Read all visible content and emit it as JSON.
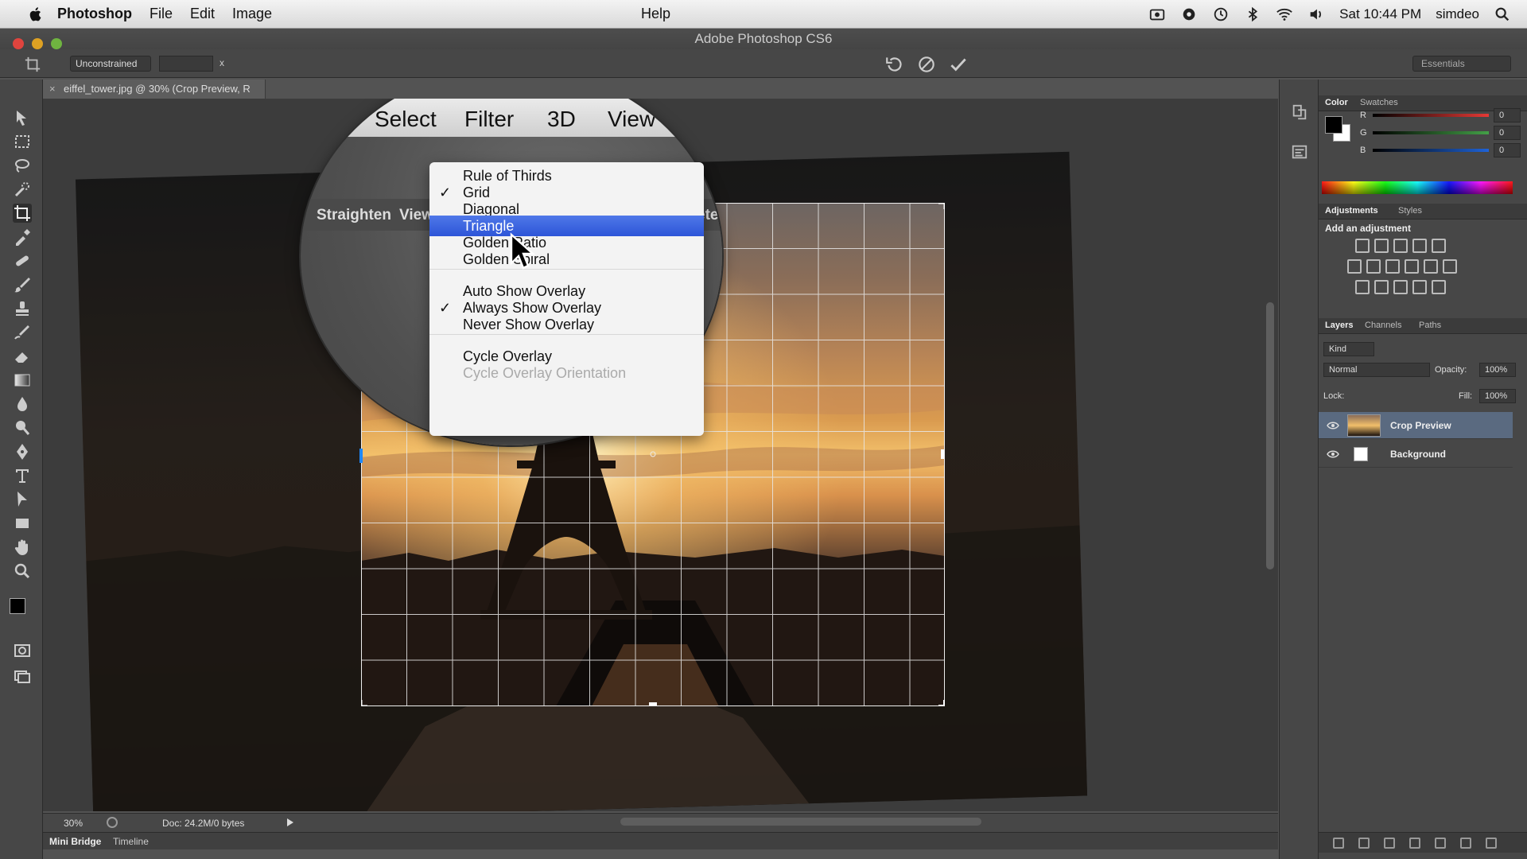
{
  "menubar": {
    "app_name": "Photoshop",
    "items": [
      "File",
      "Edit",
      "Image"
    ],
    "clock": "Sat 10:44 PM",
    "user": "simdeo"
  },
  "window": {
    "title": "Adobe Photoshop CS6"
  },
  "options_bar": {
    "ratio_select": "Unconstrained",
    "ratio_separator": "x",
    "workspace": "Essentials"
  },
  "document_tab": {
    "title": "eiffel_tower.jpg @ 30% (Crop Preview, R"
  },
  "loupe": {
    "menu_fragment": "e",
    "menu_select": "Select",
    "menu_filter": "Filter",
    "menu_3d": "3D",
    "menu_view": "View",
    "menu_help": "Help",
    "toolbar_straighten": "Straighten",
    "toolbar_view": "View",
    "toolbar_fragment": "ete"
  },
  "overlay_menu": {
    "items": [
      {
        "label": "Rule of Thirds",
        "checked": false
      },
      {
        "label": "Grid",
        "checked": true
      },
      {
        "label": "Diagonal",
        "checked": false
      },
      {
        "label": "Triangle",
        "checked": false,
        "selected": true
      },
      {
        "label": "Golden Ratio",
        "checked": false
      },
      {
        "label": "Golden Spiral",
        "checked": false
      },
      {
        "label": "Auto Show Overlay",
        "checked": false
      },
      {
        "label": "Always Show Overlay",
        "checked": true
      },
      {
        "label": "Never Show Overlay",
        "checked": false
      },
      {
        "label": "Cycle Overlay",
        "checked": false
      },
      {
        "label": "Cycle Overlay Orientation",
        "checked": false,
        "disabled": true
      }
    ],
    "check_glyph": "✓"
  },
  "statusbar": {
    "zoom": "30%",
    "doc_size": "Doc: 24.2M/0 bytes"
  },
  "bottom_tabs": [
    "Mini Bridge",
    "Timeline"
  ],
  "color_panel": {
    "tabs": [
      "Color",
      "Swatches"
    ],
    "channels": [
      {
        "label": "R",
        "value": "0",
        "color": "#e53935"
      },
      {
        "label": "G",
        "value": "0",
        "color": "#43a047"
      },
      {
        "label": "B",
        "value": "0",
        "color": "#1e63d8"
      }
    ]
  },
  "adjustments_panel": {
    "tabs": [
      "Adjustments",
      "Styles"
    ],
    "title": "Add an adjustment"
  },
  "layers_panel": {
    "tabs": [
      "Layers",
      "Channels",
      "Paths"
    ],
    "kind_filter": "Kind",
    "blend_mode": "Normal",
    "opacity_label": "Opacity:",
    "opacity_value": "100%",
    "lock_label": "Lock:",
    "fill_label": "Fill:",
    "fill_value": "100%",
    "layers": [
      {
        "name": "Crop Preview",
        "selected": true
      },
      {
        "name": "Background",
        "selected": false
      }
    ]
  },
  "colors": {
    "menu_highlight": "#2d55d8",
    "layer_selected": "#5a6a80",
    "panel_bg": "#474747"
  }
}
